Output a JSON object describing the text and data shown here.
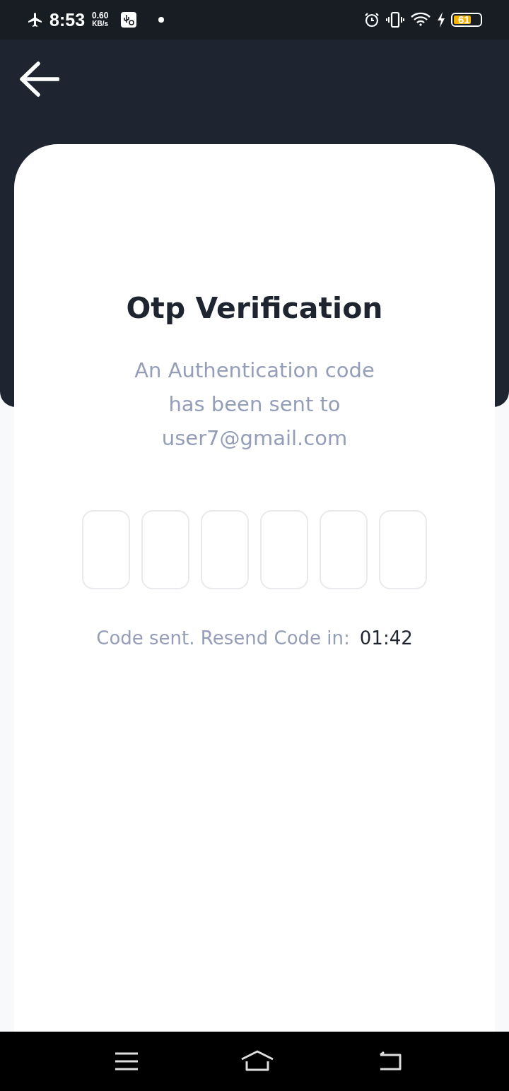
{
  "status_bar": {
    "time": "8:53",
    "speed_value": "0.60",
    "speed_unit": "KB/s",
    "battery": "61"
  },
  "card": {
    "title": "Otp Verification",
    "message": "An Authentication code has been sent to user7@gmail.com",
    "otp_fields": [
      {
        "kind": "digit"
      },
      {
        "kind": "digit"
      },
      {
        "kind": "digit"
      },
      {
        "kind": "digit"
      },
      {
        "kind": "digit"
      },
      {
        "kind": "digit"
      }
    ],
    "resend_label": "Code sent. Resend Code in:",
    "countdown": "01:42"
  }
}
